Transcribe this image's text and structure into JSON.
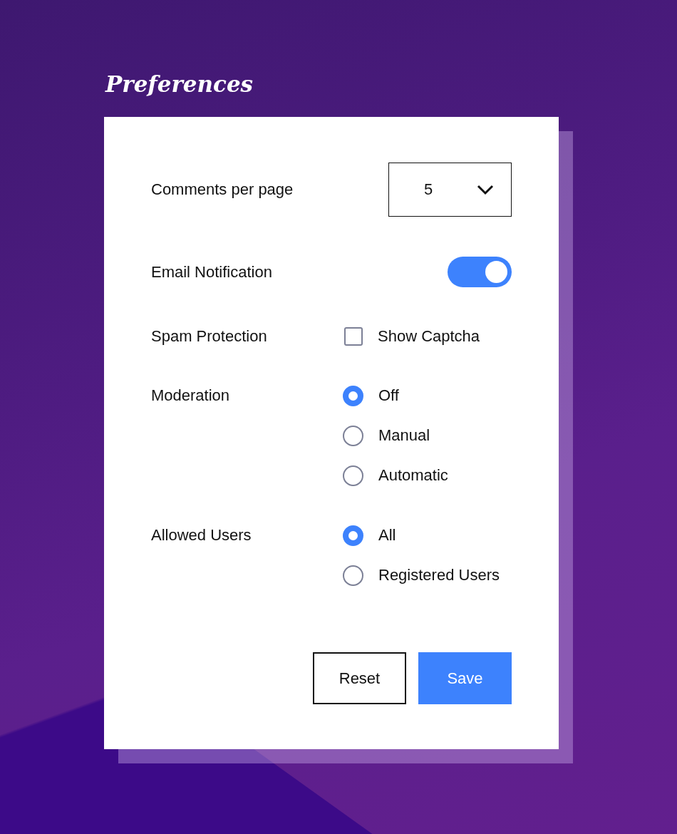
{
  "title": "Preferences",
  "settings": [
    {
      "kind": "select",
      "label": "Comments per page",
      "value": "5"
    },
    {
      "kind": "toggle",
      "label": "Email Notification",
      "on": true
    },
    {
      "kind": "checkbox",
      "label": "Spam Protection",
      "option": "Show Captcha",
      "checked": false
    },
    {
      "kind": "radio",
      "label": "Moderation",
      "options": [
        {
          "label": "Off",
          "selected": true
        },
        {
          "label": "Manual",
          "selected": false
        },
        {
          "label": "Automatic",
          "selected": false
        }
      ]
    },
    {
      "kind": "radio",
      "label": "Allowed Users",
      "options": [
        {
          "label": "All",
          "selected": true
        },
        {
          "label": "Registered Users",
          "selected": false
        }
      ]
    }
  ],
  "buttons": [
    {
      "kind": "secondary",
      "label": "Reset"
    },
    {
      "kind": "primary",
      "label": "Save"
    }
  ]
}
